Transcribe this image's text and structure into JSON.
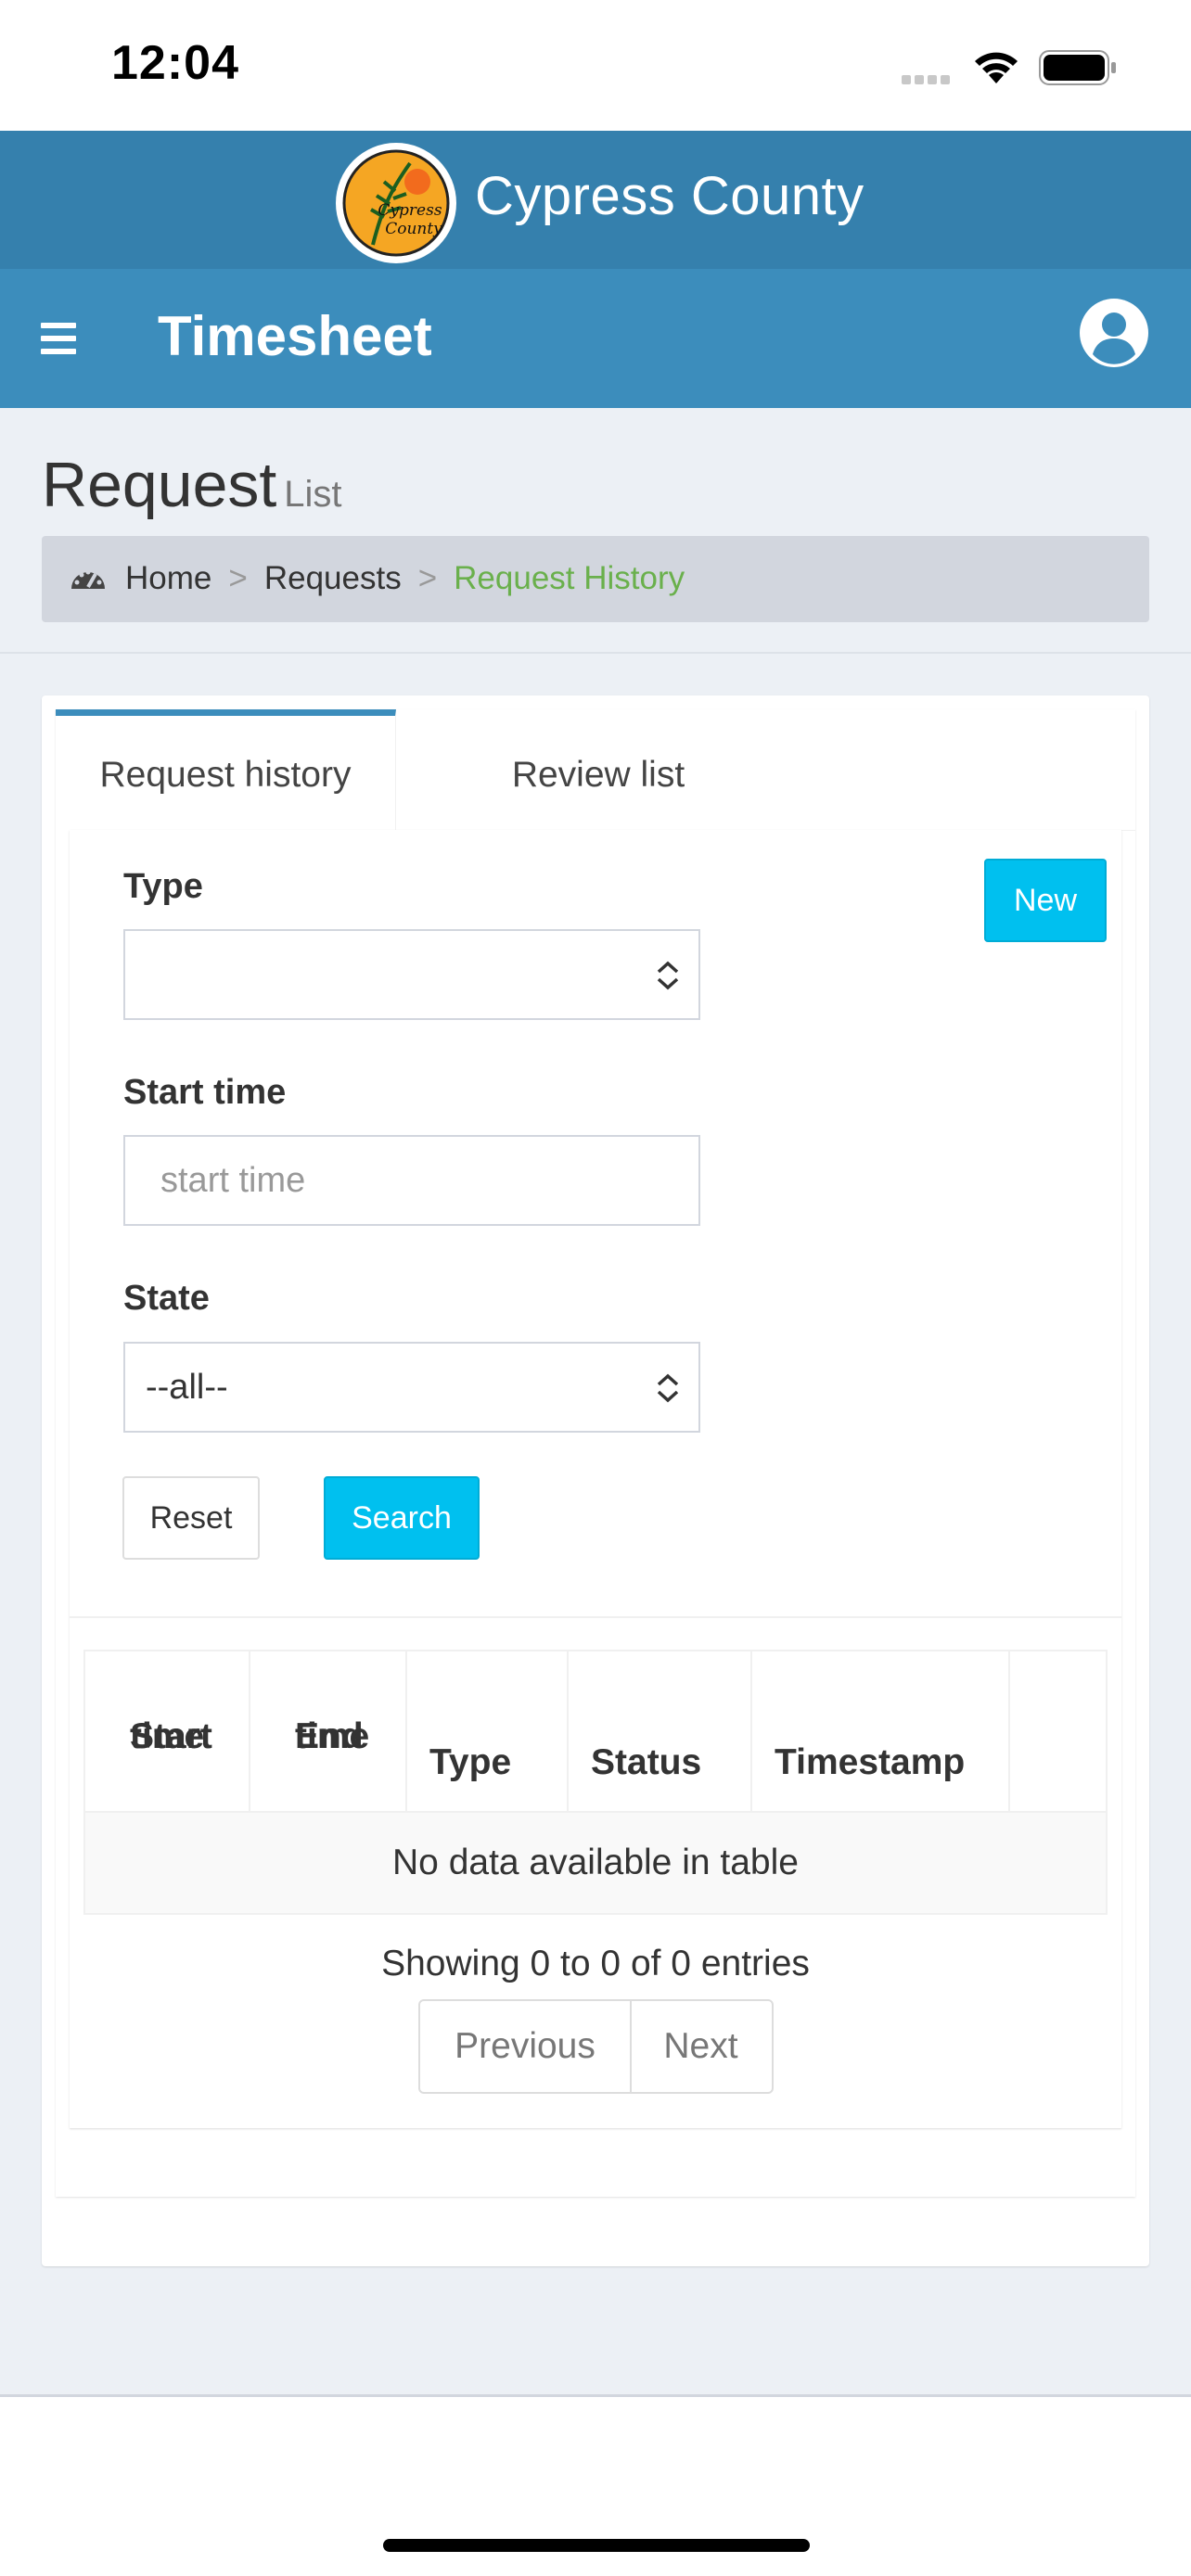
{
  "status_bar": {
    "time": "12:04"
  },
  "banner": {
    "org_name": "Cypress County",
    "logo_text_1": "Cypress",
    "logo_text_2": "County",
    "color": "#3580ad"
  },
  "header": {
    "title": "Timesheet",
    "color": "#3c8dbc"
  },
  "page": {
    "title": "Request",
    "subtitle": "List"
  },
  "breadcrumb": {
    "items": [
      "Home",
      "Requests",
      "Request History"
    ],
    "separator": ">"
  },
  "tabs": [
    {
      "label": "Request history",
      "active": true
    },
    {
      "label": "Review list",
      "active": false
    }
  ],
  "actions": {
    "new_label": "New",
    "reset_label": "Reset",
    "search_label": "Search"
  },
  "filters": {
    "type": {
      "label": "Type",
      "value": ""
    },
    "start_time": {
      "label": "Start time",
      "placeholder": "start time",
      "value": ""
    },
    "state": {
      "label": "State",
      "value": "--all--"
    }
  },
  "table": {
    "columns": [
      {
        "line1": "Start",
        "line2": "time"
      },
      {
        "line1": "End",
        "line2": "time"
      },
      {
        "line1": "",
        "line2": "Type"
      },
      {
        "line1": "",
        "line2": "Status"
      },
      {
        "line1": "",
        "line2": "Timestamp"
      },
      {
        "line1": "",
        "line2": ""
      }
    ],
    "empty_message": "No data available in table"
  },
  "pagination": {
    "info": "Showing 0 to 0 of 0 entries",
    "previous": "Previous",
    "next": "Next"
  },
  "colors": {
    "accent": "#00c0ef",
    "breadcrumb_active": "#6ab04c",
    "content_bg": "#ecf0f5"
  }
}
